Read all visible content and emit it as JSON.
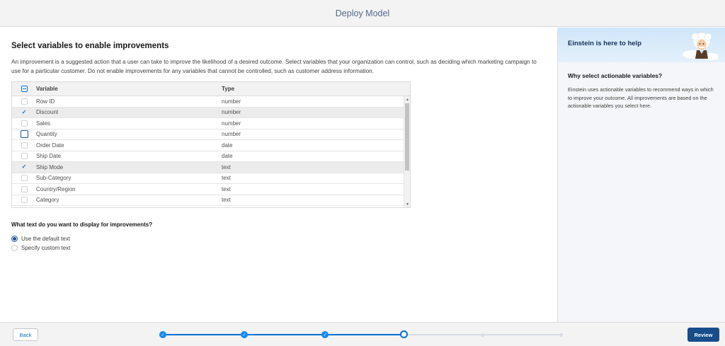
{
  "header": {
    "title": "Deploy Model"
  },
  "main": {
    "title": "Select variables to enable improvements",
    "description": "An improvement is a suggested action that a user can take to improve the likelihood of a desired outcome. Select variables that your organization can control, such as deciding which marketing campaign to use for a particular customer. Do not enable improvements for any variables that cannot be controlled, such as customer address information.",
    "table": {
      "columns": [
        "Variable",
        "Type"
      ],
      "rows": [
        {
          "variable": "Row ID",
          "type": "number",
          "checked": false
        },
        {
          "variable": "Discount",
          "type": "number",
          "checked": true
        },
        {
          "variable": "Sales",
          "type": "number",
          "checked": false
        },
        {
          "variable": "Quantity",
          "type": "number",
          "checked": false
        },
        {
          "variable": "Order Date",
          "type": "date",
          "checked": false
        },
        {
          "variable": "Ship Date",
          "type": "date",
          "checked": false
        },
        {
          "variable": "Ship Mode",
          "type": "text",
          "checked": true
        },
        {
          "variable": "Sub-Category",
          "type": "text",
          "checked": false
        },
        {
          "variable": "Country/Region",
          "type": "text",
          "checked": false
        },
        {
          "variable": "Category",
          "type": "text",
          "checked": false
        }
      ]
    },
    "question": "What text do you want to display for improvements?",
    "options": [
      {
        "label": "Use the default text",
        "selected": true
      },
      {
        "label": "Specify custom text",
        "selected": false
      }
    ]
  },
  "helper": {
    "banner_title": "Einstein is here to help",
    "question": "Why select actionable variables?",
    "answer": "Einstein uses actionable variables to recommend ways in which to improve your outcome. All improvements are based on the actionable variables you select here."
  },
  "footer": {
    "back_label": "Back",
    "review_label": "Review",
    "steps": [
      "done",
      "done",
      "done",
      "current",
      "todo",
      "todo"
    ]
  },
  "icons": {
    "check": "✓",
    "scroll_up": "▲",
    "scroll_down": "▼"
  },
  "colors": {
    "accent": "#0070d2",
    "brand_dark": "#164d8a",
    "helper_title": "#16325c"
  }
}
